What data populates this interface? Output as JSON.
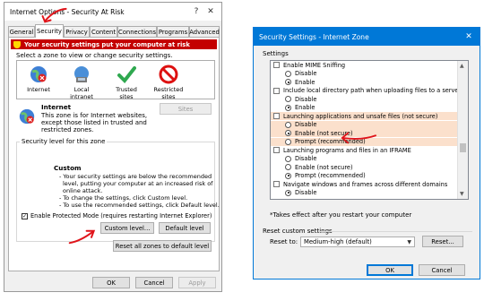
{
  "left_dialog": {
    "title": "Internet Options - Security At Risk",
    "tabs": [
      "General",
      "Security",
      "Privacy",
      "Content",
      "Connections",
      "Programs",
      "Advanced"
    ],
    "warning": "Your security settings put your computer at risk",
    "select_zone": "Select a zone to view or change security settings.",
    "zones": [
      "Internet",
      "Local intranet",
      "Trusted sites",
      "Restricted sites"
    ],
    "zone_heading": "Internet",
    "zone_desc": [
      "This zone is for Internet websites,",
      "except those listed in trusted and",
      "restricted zones."
    ],
    "sites_button": "Sites",
    "level_group": "Security level for this zone",
    "level_name": "Custom",
    "level_lines": [
      "- Your security settings are below the recommended",
      "level, putting your computer at an increased risk of",
      "online attack.",
      "- To change the settings, click Custom level.",
      "- To use the recommended settings, click Default level."
    ],
    "protected_mode": "Enable Protected Mode (requires restarting Internet Explorer)",
    "custom_level_button": "Custom level...",
    "default_level_button": "Default level",
    "reset_all_button": "Reset all zones to default level",
    "ok": "OK",
    "cancel": "Cancel",
    "apply": "Apply"
  },
  "right_dialog": {
    "title": "Security Settings - Internet Zone",
    "settings_label": "Settings",
    "rows": [
      {
        "kind": "box",
        "text": "Enable MIME Sniffing"
      },
      {
        "kind": "rad",
        "text": "Disable",
        "on": false
      },
      {
        "kind": "rad",
        "text": "Enable",
        "on": true
      },
      {
        "kind": "box",
        "text": "Include local directory path when uploading files to a server"
      },
      {
        "kind": "rad",
        "text": "Disable",
        "on": false
      },
      {
        "kind": "rad",
        "text": "Enable",
        "on": true
      },
      {
        "kind": "box",
        "text": "Launching applications and unsafe files (not secure)",
        "hl": true
      },
      {
        "kind": "rad",
        "text": "Disable",
        "on": false,
        "hl": true
      },
      {
        "kind": "rad",
        "text": "Enable (not secure)",
        "on": true,
        "hl": true
      },
      {
        "kind": "rad",
        "text": "Prompt (recommended)",
        "on": false,
        "hl": true
      },
      {
        "kind": "box",
        "text": "Launching programs and files in an IFRAME"
      },
      {
        "kind": "rad",
        "text": "Disable",
        "on": false
      },
      {
        "kind": "rad",
        "text": "Enable (not secure)",
        "on": false
      },
      {
        "kind": "rad",
        "text": "Prompt (recommended)",
        "on": true
      },
      {
        "kind": "box",
        "text": "Navigate windows and frames across different domains"
      },
      {
        "kind": "rad",
        "text": "Disable",
        "on": true
      }
    ],
    "note": "*Takes effect after you restart your computer",
    "reset_group": "Reset custom settings",
    "reset_to_label": "Reset to:",
    "reset_to_value": "Medium-high (default)",
    "reset_button": "Reset...",
    "ok": "OK",
    "cancel": "Cancel"
  },
  "colors": {
    "annotation": "#e0141a",
    "warning_bar": "#c40000",
    "highlight": "#fbe0cc"
  },
  "icons": [
    "globe-icon",
    "intranet-icon",
    "checkmark-icon",
    "restricted-icon",
    "warning-shield-icon",
    "close-icon",
    "help-icon",
    "scroll-up-icon",
    "scroll-down-icon",
    "dropdown-icon"
  ]
}
